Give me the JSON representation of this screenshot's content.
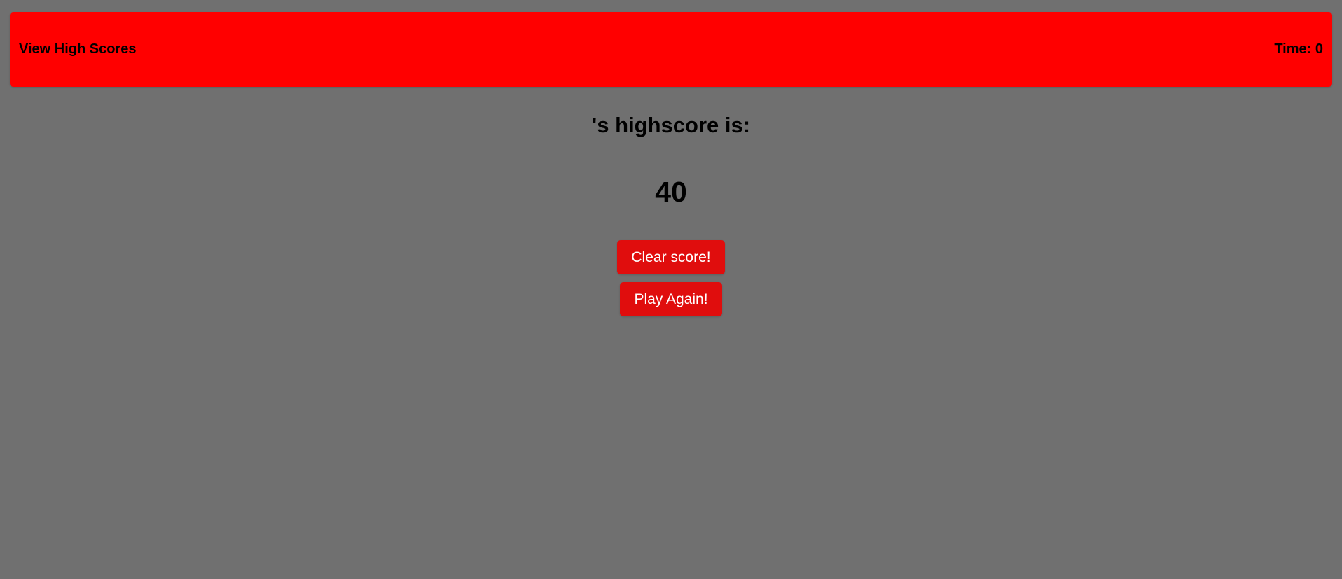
{
  "header": {
    "high_scores_link": "View High Scores",
    "timer": "Time: 0"
  },
  "main": {
    "title": "'s highscore is:",
    "score": "40",
    "clear_button": "Clear score!",
    "play_again_button": "Play Again!"
  },
  "colors": {
    "background": "#707070",
    "header_bg": "#ff0000",
    "button_bg": "#e00d0d",
    "button_text": "#ffffff",
    "text": "#000000"
  }
}
